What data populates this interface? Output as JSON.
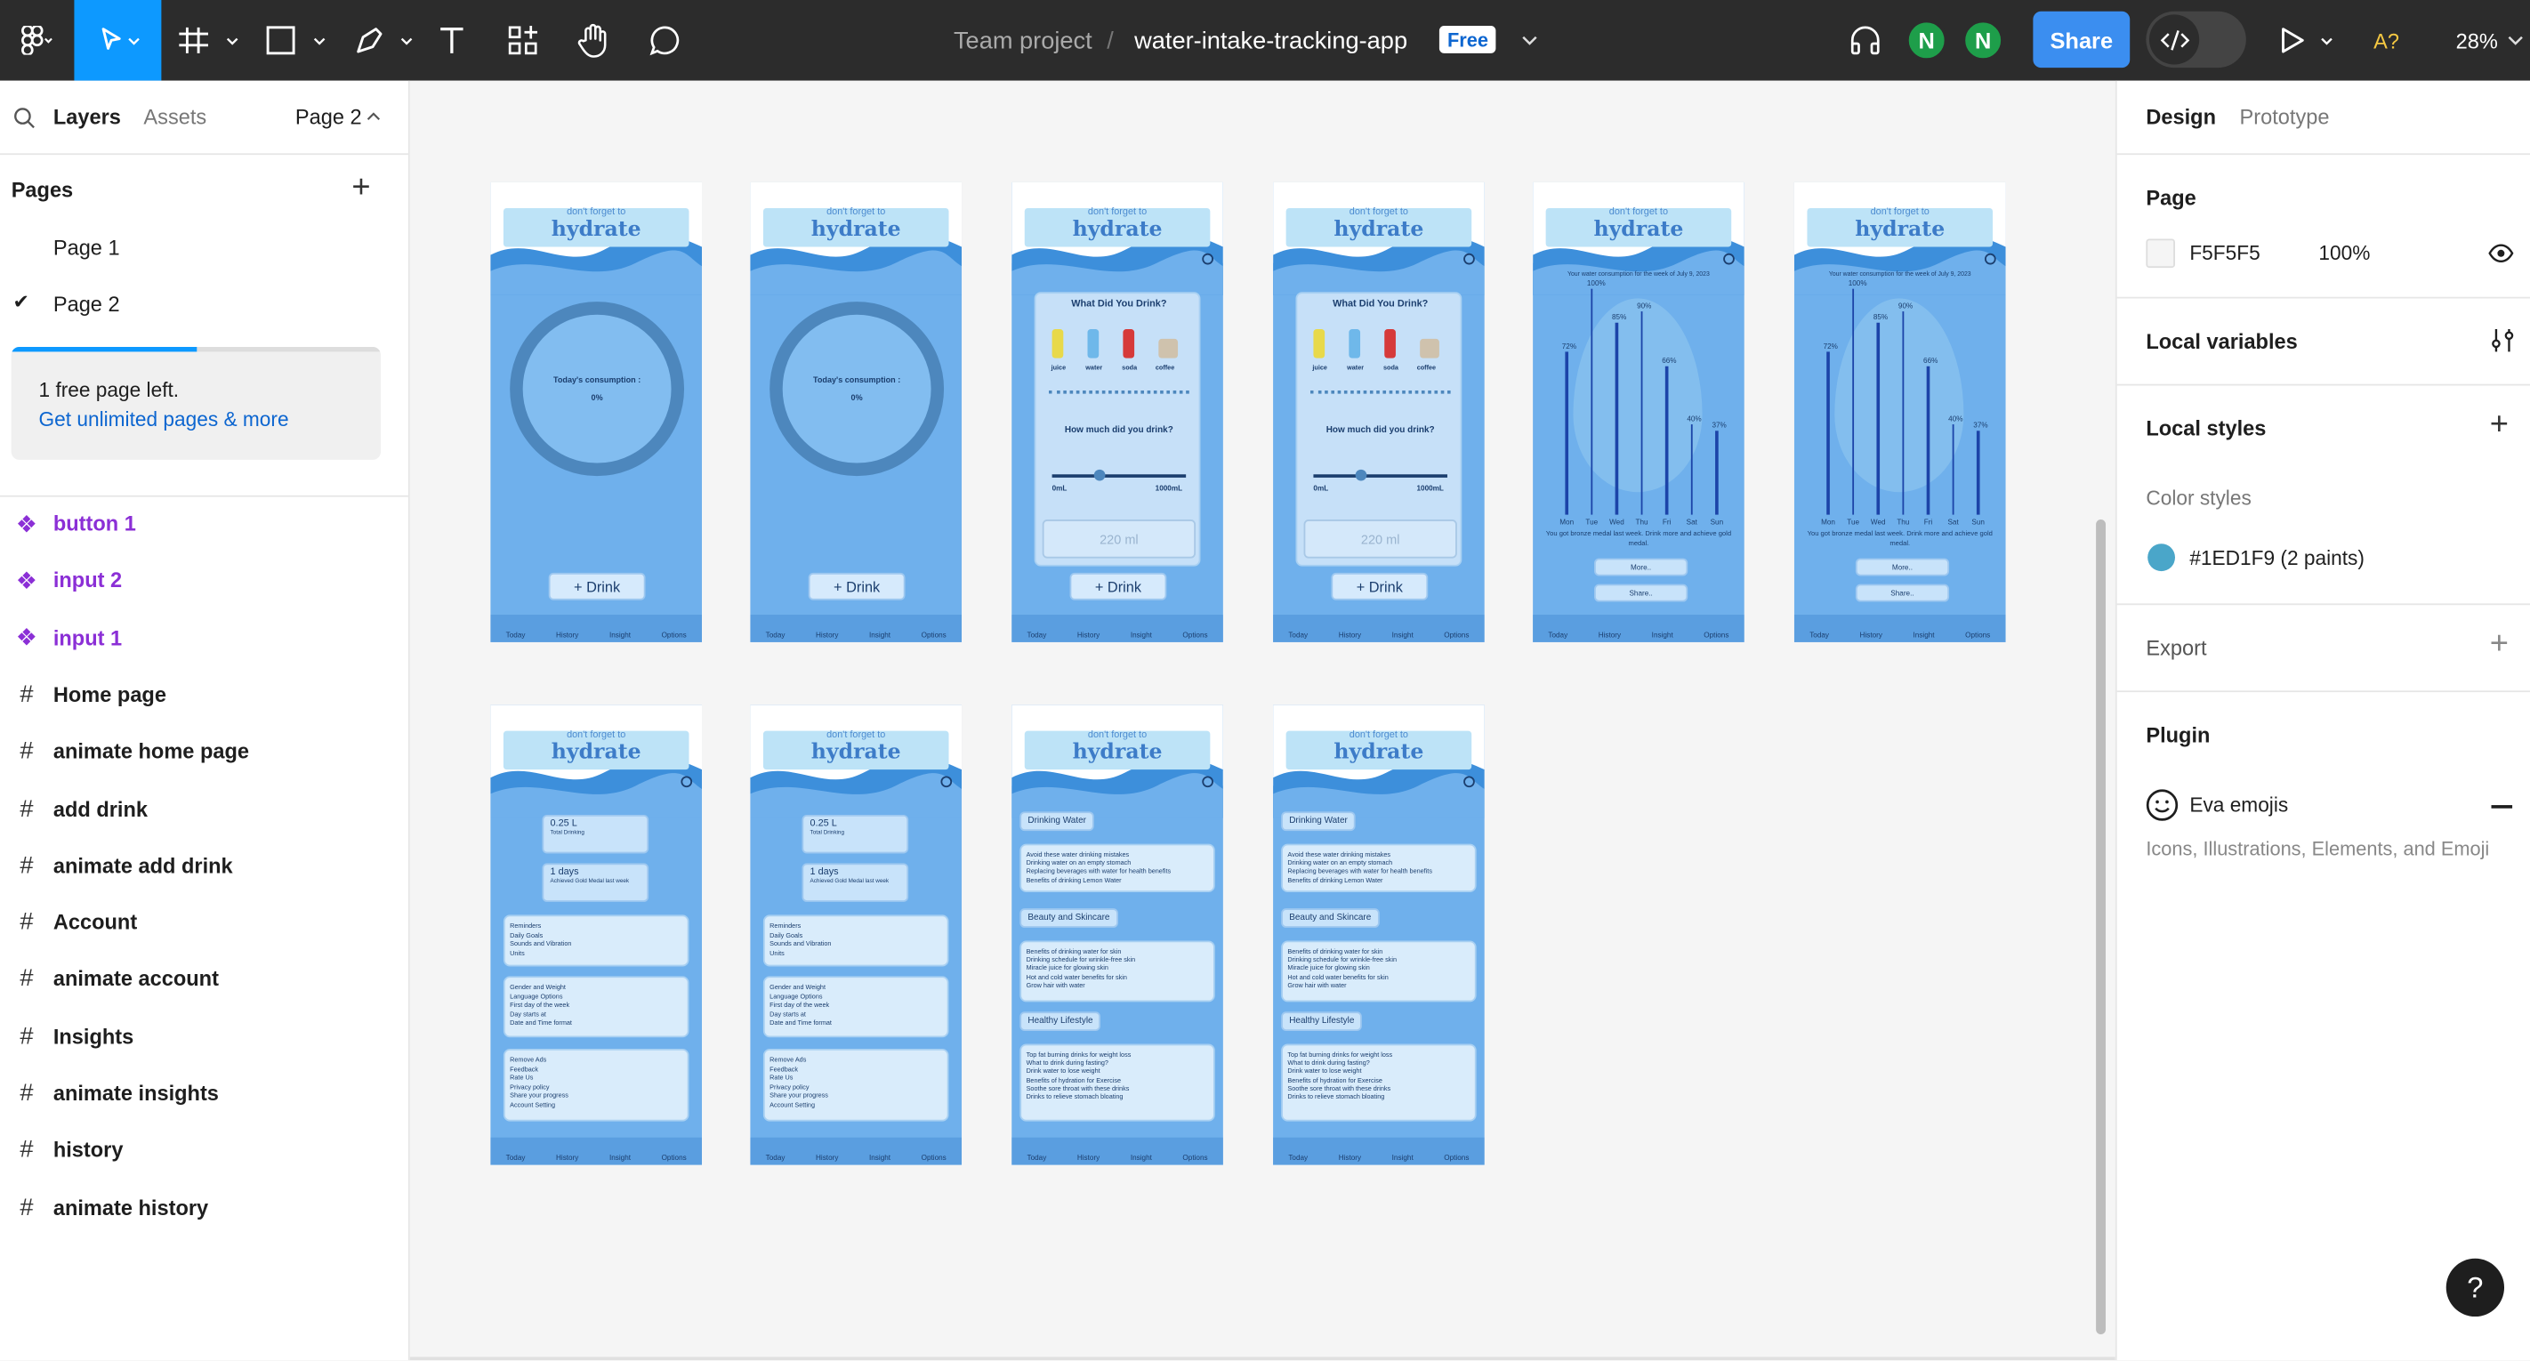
{
  "topbar": {
    "project": "Team project",
    "separator": "/",
    "file_name": "water-intake-tracking-app",
    "plan_badge": "Free",
    "avatars": [
      "N",
      "N"
    ],
    "share_label": "Share",
    "zoom": "28%",
    "accessibility_badge": "A?"
  },
  "left_panel": {
    "tabs": {
      "layers": "Layers",
      "assets": "Assets"
    },
    "page_selector": "Page 2",
    "pages_title": "Pages",
    "pages": [
      {
        "label": "Page 1",
        "selected": false
      },
      {
        "label": "Page 2",
        "selected": true
      }
    ],
    "quota": {
      "text": "1 free page left.",
      "link": "Get unlimited pages & more",
      "fill": 0.5
    },
    "layers": [
      {
        "label": "button 1",
        "type": "component"
      },
      {
        "label": "input 2",
        "type": "component"
      },
      {
        "label": "input 1",
        "type": "component"
      },
      {
        "label": "Home page",
        "type": "frame"
      },
      {
        "label": "animate home page",
        "type": "frame"
      },
      {
        "label": "add drink",
        "type": "frame"
      },
      {
        "label": "animate add drink",
        "type": "frame"
      },
      {
        "label": "Account",
        "type": "frame"
      },
      {
        "label": "animate account",
        "type": "frame"
      },
      {
        "label": "Insights",
        "type": "frame"
      },
      {
        "label": "animate insights",
        "type": "frame"
      },
      {
        "label": "history",
        "type": "frame"
      },
      {
        "label": "animate history",
        "type": "frame"
      }
    ]
  },
  "canvas": {
    "frames": [
      {
        "title": "Home page",
        "kind": "home"
      },
      {
        "title": "animate home page",
        "kind": "home"
      },
      {
        "title": "add drink",
        "kind": "add"
      },
      {
        "title": "animate add drink",
        "kind": "add"
      },
      {
        "title": "history",
        "kind": "history"
      },
      {
        "title": "animate history",
        "kind": "history"
      },
      {
        "title": "Account",
        "kind": "account"
      },
      {
        "title": "animate account",
        "kind": "account"
      },
      {
        "title": "Insights",
        "kind": "insights"
      },
      {
        "title": "animate insights",
        "kind": "insights"
      }
    ],
    "mock": {
      "banner_top": "don't forget to",
      "banner_word": "hydrate",
      "nav": [
        "Today",
        "History",
        "Insight",
        "Options"
      ],
      "drink_button": "+ Drink",
      "today_label": "Today's consumption :",
      "today_value": "0%",
      "what_title": "What Did You Drink?",
      "drinks": [
        "juice",
        "water",
        "soda",
        "coffee"
      ],
      "how_much": "How much did you drink?",
      "slider_min": "0mL",
      "slider_max": "1000mL",
      "amount": "220 ml",
      "history_caption": "Your water consumption for the week of July 9, 2023",
      "history_days": [
        "Mon",
        "Tue",
        "Wed",
        "Thu",
        "Fri",
        "Sat",
        "Sun"
      ],
      "history_percent_labels": [
        "100%",
        "90%",
        "85%",
        "72%",
        "66%",
        "40%",
        "37%"
      ],
      "history_values": [
        72,
        100,
        85,
        90,
        66,
        40,
        37
      ],
      "history_footer": "You got bronze medal last week. Drink more and achieve gold medal.",
      "more_btn": "More..",
      "share_btn": "Share..",
      "account_total": "0.25 L",
      "account_total_sub": "Total Drinking",
      "account_days": "1 days",
      "account_days_sub": "Achieved Gold Medal last week",
      "account_group1": [
        "Reminders",
        "Daily Goals",
        "Sounds and Vibration",
        "Units"
      ],
      "account_group2": [
        "Gender and Weight",
        "Language Options",
        "First day of the week",
        "Day starts at",
        "Date and Time format"
      ],
      "account_group3": [
        "Remove Ads",
        "Feedback",
        "Rate Us",
        "Privacy policy",
        "Share your progress",
        "Account Setting"
      ],
      "insight_sections": [
        {
          "title": "Drinking Water",
          "items": [
            "Avoid these water drinking mistakes",
            "Drinking water on an empty stomach",
            "Replacing beverages with water for health benefits",
            "Benefits of drinking Lemon Water"
          ]
        },
        {
          "title": "Beauty and Skincare",
          "items": [
            "Benefits of drinking water for skin",
            "Drinking schedule for wrinkle-free skin",
            "Miracle juice for glowing skin",
            "Hot and cold water benefits for skin",
            "Grow hair with water"
          ]
        },
        {
          "title": "Healthy Lifestyle",
          "items": [
            "Top fat burning drinks for weight loss",
            "What to drink during fasting?",
            "Drink water to lose weight",
            "Benefits of hydration for Exercise",
            "Soothe sore throat with these drinks",
            "Drinks to relieve stomach bloating"
          ]
        }
      ]
    }
  },
  "right_panel": {
    "tabs": {
      "design": "Design",
      "prototype": "Prototype"
    },
    "page_title": "Page",
    "page_color": "F5F5F5",
    "page_opacity": "100%",
    "local_variables": "Local variables",
    "local_styles": "Local styles",
    "color_styles_title": "Color styles",
    "color_style": {
      "name": "#1ED1F9 (2 paints)",
      "swatch": "#4aa6c9"
    },
    "export": "Export",
    "plugin_title": "Plugin",
    "plugin_name": "Eva emojis",
    "plugin_desc": "Icons, Illustrations, Elements, and Emoji"
  },
  "colors": {
    "accent": "#0d99ff",
    "share": "#3b8ef0",
    "component": "#8b2fd6",
    "avatar": "#1e9e4a"
  }
}
